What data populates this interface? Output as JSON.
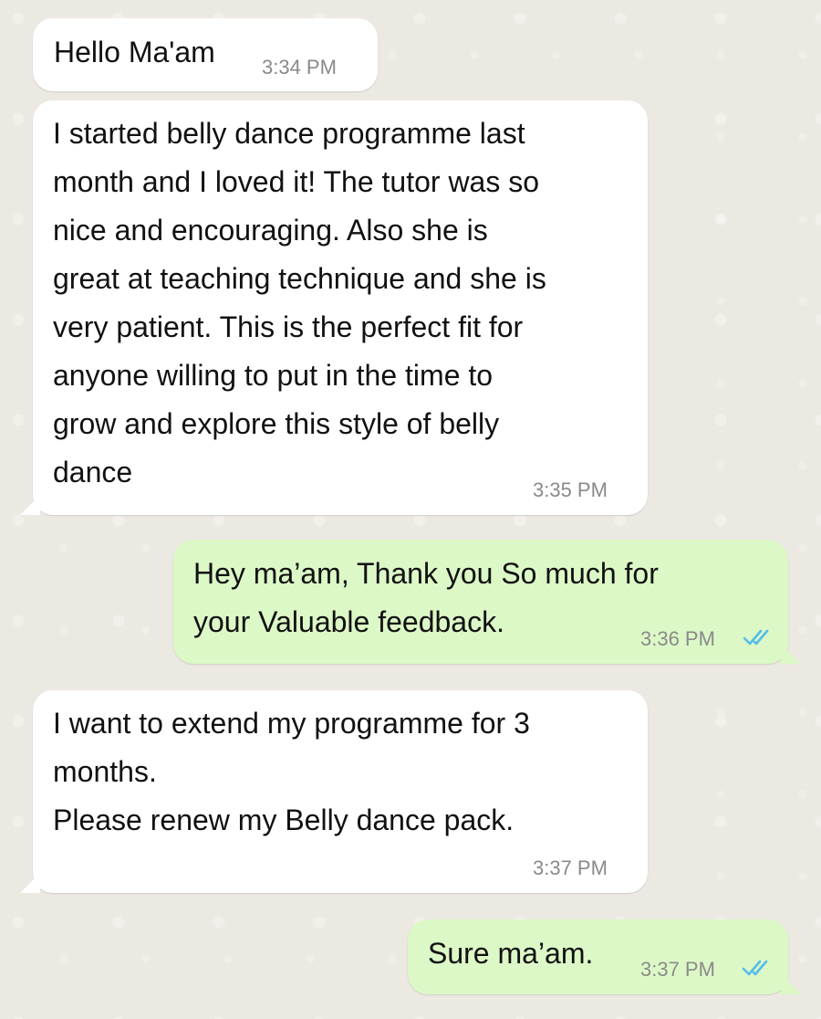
{
  "messages": [
    {
      "direction": "incoming",
      "text": "Hello Ma'am",
      "time": "3:34 PM"
    },
    {
      "direction": "incoming",
      "text": "I started belly dance programme last\nmonth and I loved it! The tutor was so\nnice and encouraging. Also she is\ngreat at teaching technique and she is\nvery patient. This is the perfect fit for\nanyone willing to put in the time to\ngrow and explore this style of belly\ndance",
      "time": "3:35 PM"
    },
    {
      "direction": "outgoing",
      "text": "Hey ma’am, Thank you So much for\nyour Valuable feedback.",
      "time": "3:36 PM",
      "status": "read"
    },
    {
      "direction": "incoming",
      "text": "I want to extend my programme for 3\nmonths.\nPlease renew my Belly dance pack.",
      "time": "3:37 PM"
    },
    {
      "direction": "outgoing",
      "text": "Sure ma’am.",
      "time": "3:37 PM",
      "status": "read"
    }
  ],
  "colors": {
    "incoming_bubble": "#ffffff",
    "outgoing_bubble": "#dcf8c6",
    "read_ticks": "#53bdeb",
    "timestamp": "#8a8a8a",
    "background": "#ece8e2"
  },
  "icons": {
    "read_receipt": "double-check-icon"
  }
}
